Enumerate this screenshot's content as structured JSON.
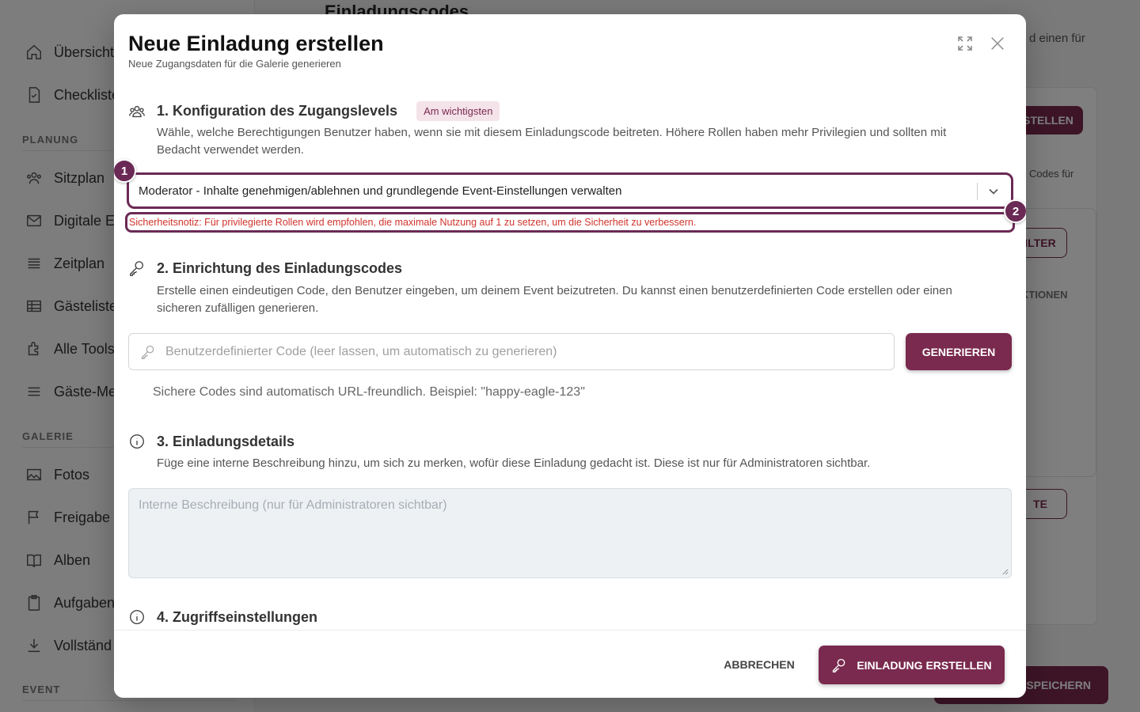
{
  "background": {
    "sidebar": {
      "items": [
        {
          "label": "Übersicht",
          "icon": "home-icon"
        },
        {
          "label": "Checkliste",
          "icon": "checklist-icon"
        },
        {
          "label": "Sitzplan",
          "icon": "people-icon"
        },
        {
          "label": "Digitale E",
          "icon": "mail-icon"
        },
        {
          "label": "Zeitplan",
          "icon": "list-icon"
        },
        {
          "label": "Gästeliste",
          "icon": "table-icon"
        },
        {
          "label": "Alle Tools",
          "icon": "puzzle-icon"
        },
        {
          "label": "Gäste-Me",
          "icon": "menu-icon"
        },
        {
          "label": "Fotos",
          "icon": "image-icon"
        },
        {
          "label": "Freigabe",
          "icon": "flag-icon"
        },
        {
          "label": "Alben",
          "icon": "book-icon"
        },
        {
          "label": "Aufgaben",
          "icon": "clipboard-icon"
        },
        {
          "label": "Vollständ",
          "icon": "download-icon"
        }
      ],
      "sections": [
        "PLANUNG",
        "GALERIE",
        "EVENT"
      ]
    },
    "page_title": "Einladungscodes",
    "desc_fragment": "d einen für",
    "create_button": "STELLEN",
    "codes_fragment": "Codes für",
    "filter_button": "ILTER",
    "actions_header": "KTIONEN",
    "next_button": "TE",
    "save_button": "SPEICHERN"
  },
  "modal": {
    "title": "Neue Einladung erstellen",
    "subtitle": "Neue Zugangsdaten für die Galerie generieren",
    "section1": {
      "title": "1. Konfiguration des Zugangslevels",
      "badge": "Am wichtigsten",
      "description": "Wähle, welche Berechtigungen Benutzer haben, wenn sie mit diesem Einladungscode beitreten. Höhere Rollen haben mehr Privilegien und sollten mit Bedacht verwendet werden.",
      "role_value": "Moderator - Inhalte genehmigen/ablehnen und grundlegende Event-Einstellungen verwalten",
      "security_notice": "Sicherheitsnotiz: Für privilegierte Rollen wird empfohlen, die maximale Nutzung auf 1 zu setzen, um die Sicherheit zu verbessern."
    },
    "section2": {
      "title": "2. Einrichtung des Einladungscodes",
      "description": "Erstelle einen eindeutigen Code, den Benutzer eingeben, um deinem Event beizutreten. Du kannst einen benutzerdefinierten Code erstellen oder einen sicheren zufälligen generieren.",
      "code_placeholder": "Benutzerdefinierter Code (leer lassen, um automatisch zu generieren)",
      "code_value": "",
      "generate_label": "GENERIEREN",
      "helper": "Sichere Codes sind automatisch URL-freundlich. Beispiel: \"happy-eagle-123\""
    },
    "section3": {
      "title": "3. Einladungsdetails",
      "description": "Füge eine interne Beschreibung hinzu, um sich zu merken, wofür diese Einladung gedacht ist. Diese ist nur für Administratoren sichtbar.",
      "placeholder": "Interne Beschreibung (nur für Administratoren sichtbar)",
      "value": ""
    },
    "section4": {
      "title": "4. Zugriffseinstellungen"
    },
    "footer": {
      "cancel_label": "ABBRECHEN",
      "create_label": "EINLADUNG ERSTELLEN"
    },
    "markers": [
      "1",
      "2"
    ]
  },
  "colors": {
    "accent": "#7a2a4e",
    "highlight": "#6b2a55",
    "error": "#d0342c",
    "badge_bg": "#f5e3ea"
  }
}
